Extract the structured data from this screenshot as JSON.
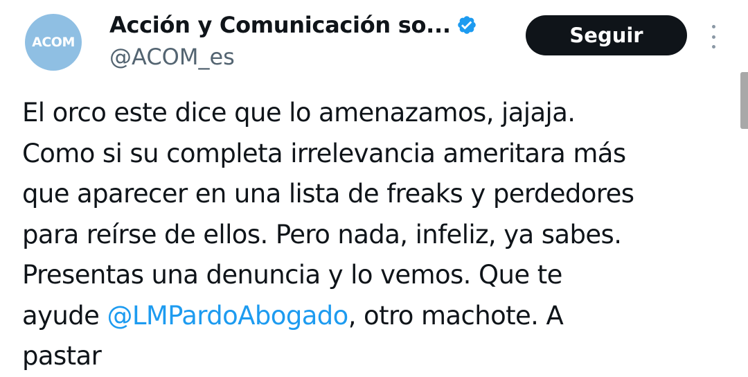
{
  "colors": {
    "avatar_bg": "#8fbfe3",
    "verified": "#1d9bf0",
    "follow_bg": "#0f1419",
    "mention": "#1d9bf0",
    "handle": "#536471"
  },
  "author": {
    "avatar_text": "ACOM",
    "display_name": "Acción y Comunicación so...",
    "verified_icon": "verified-badge-icon",
    "handle": "@ACOM_es"
  },
  "actions": {
    "follow_label": "Seguir",
    "more_icon": "more-vertical-icon"
  },
  "tweet": {
    "line1": "El orco este dice que lo amenazamos, jajaja.",
    "line2": "Como si su completa irrelevancia ameritara más",
    "line3": "que aparecer en una lista de freaks y perdedores",
    "line4": "para reírse de ellos. Pero nada, infeliz, ya sabes.",
    "line5": "Presentas una denuncia y lo vemos. Que te",
    "line6_pre": "ayude ",
    "mention": "@LMPardoAbogado",
    "line6_post": ", otro machote. A",
    "line7": "pastar"
  }
}
